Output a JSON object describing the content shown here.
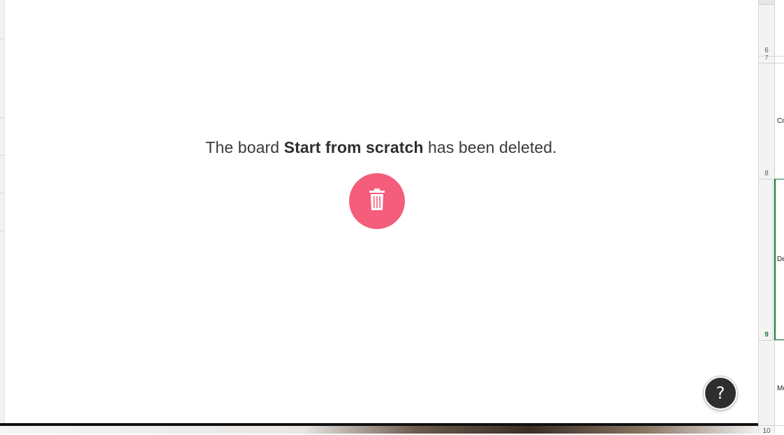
{
  "message": {
    "prefix": "The board ",
    "board_name": "Start from scratch",
    "suffix": " has been deleted."
  },
  "icons": {
    "trash": "trash-icon",
    "help": "question-mark-icon"
  },
  "help_button": {
    "label": "?"
  },
  "colors": {
    "accent_pink": "#f45d7b",
    "help_dark": "#2e2e2e",
    "spreadsheet_green": "#1e7a3c"
  },
  "spreadsheet": {
    "rows": [
      {
        "number": "6",
        "sub": "7",
        "cell": "Cr"
      },
      {
        "number": "8",
        "cell": "De"
      },
      {
        "number": "9",
        "cell": "Mo"
      },
      {
        "number": "10",
        "cell": ""
      }
    ]
  }
}
